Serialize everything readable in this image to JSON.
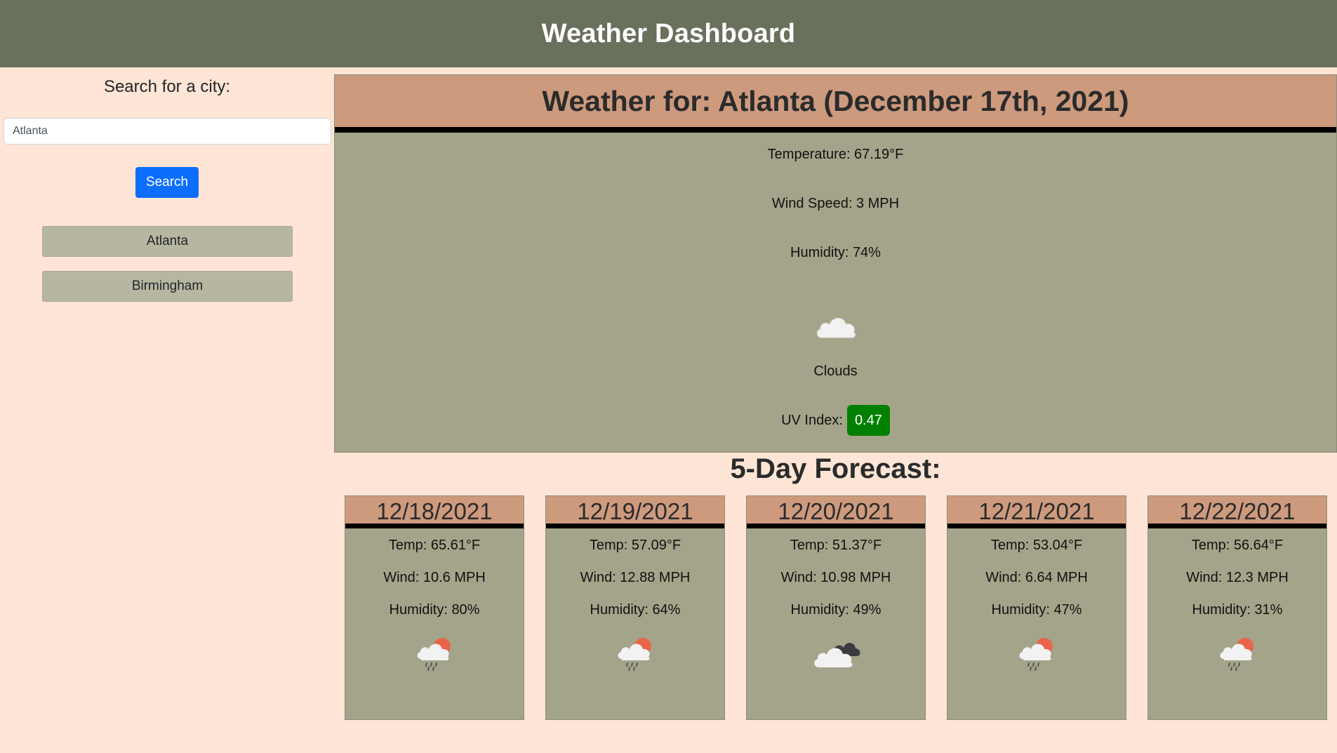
{
  "header": {
    "title": "Weather Dashboard"
  },
  "sidebar": {
    "search_label": "Search for a city:",
    "search_value": "Atlanta",
    "search_button": "Search",
    "history": [
      "Atlanta",
      "Birmingham"
    ]
  },
  "current": {
    "title": "Weather for: Atlanta (December 17th, 2021)",
    "temperature": "Temperature: 67.19°F",
    "wind": "Wind Speed: 3 MPH",
    "humidity": "Humidity: 74%",
    "icon": "clouds-icon",
    "description": "Clouds",
    "uv_label": "UV Index:",
    "uv_value": "0.47",
    "uv_color": "#008000"
  },
  "forecast": {
    "title": "5-Day Forecast:",
    "days": [
      {
        "date": "12/18/2021",
        "temp": "Temp: 65.61°F",
        "wind": "Wind: 10.6 MPH",
        "humidity": "Humidity: 80%",
        "icon": "rain-sun-icon"
      },
      {
        "date": "12/19/2021",
        "temp": "Temp: 57.09°F",
        "wind": "Wind: 12.88 MPH",
        "humidity": "Humidity: 64%",
        "icon": "rain-sun-icon"
      },
      {
        "date": "12/20/2021",
        "temp": "Temp: 51.37°F",
        "wind": "Wind: 10.98 MPH",
        "humidity": "Humidity: 49%",
        "icon": "broken-clouds-icon"
      },
      {
        "date": "12/21/2021",
        "temp": "Temp: 53.04°F",
        "wind": "Wind: 6.64 MPH",
        "humidity": "Humidity: 47%",
        "icon": "rain-sun-icon"
      },
      {
        "date": "12/22/2021",
        "temp": "Temp: 56.64°F",
        "wind": "Wind: 12.3 MPH",
        "humidity": "Humidity: 31%",
        "icon": "rain-sun-icon"
      }
    ]
  },
  "colors": {
    "header_bg": "#69705c",
    "page_bg": "#ffe5d5",
    "card_bg": "#a4a48a",
    "title_bg": "#cd9a7e",
    "button_blue": "#0d6efd",
    "history_bg": "#b7b6a0"
  }
}
